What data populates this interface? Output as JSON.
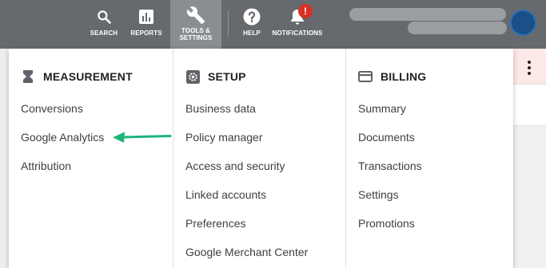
{
  "topbar": {
    "search": "SEARCH",
    "reports": "REPORTS",
    "tools_line1": "TOOLS &",
    "tools_line2": "SETTINGS",
    "help": "HELP",
    "notifications": "NOTIFICATIONS",
    "notification_badge": "!"
  },
  "menu": {
    "measurement": {
      "heading": "MEASUREMENT",
      "items": [
        "Conversions",
        "Google Analytics",
        "Attribution"
      ]
    },
    "setup": {
      "heading": "SETUP",
      "items": [
        "Business data",
        "Policy manager",
        "Access and security",
        "Linked accounts",
        "Preferences",
        "Google Merchant Center"
      ]
    },
    "billing": {
      "heading": "BILLING",
      "items": [
        "Summary",
        "Documents",
        "Transactions",
        "Settings",
        "Promotions"
      ]
    }
  },
  "colors": {
    "topbar": "#666a6e",
    "active_tab": "#8a8e93",
    "badge": "#d93025",
    "arrow": "#1db47a"
  }
}
